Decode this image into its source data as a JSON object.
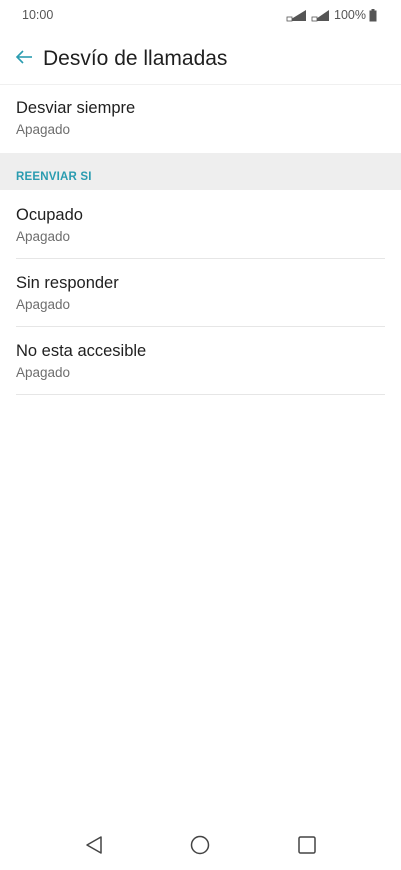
{
  "status_bar": {
    "time": "10:00",
    "battery": "100%"
  },
  "header": {
    "title": "Desvío de llamadas",
    "back_icon": "arrow-left-icon"
  },
  "colors": {
    "accent": "#2a9cb0",
    "section_bg": "#eeeeee"
  },
  "items_top": [
    {
      "title": "Desviar siempre",
      "subtitle": "Apagado"
    }
  ],
  "section": {
    "label": "REENVIAR SI"
  },
  "items_conditional": [
    {
      "title": "Ocupado",
      "subtitle": "Apagado"
    },
    {
      "title": "Sin responder",
      "subtitle": "Apagado"
    },
    {
      "title": "No esta accesible",
      "subtitle": "Apagado"
    }
  ],
  "nav": {
    "back": "nav-back-icon",
    "home": "nav-home-icon",
    "recents": "nav-recents-icon"
  }
}
